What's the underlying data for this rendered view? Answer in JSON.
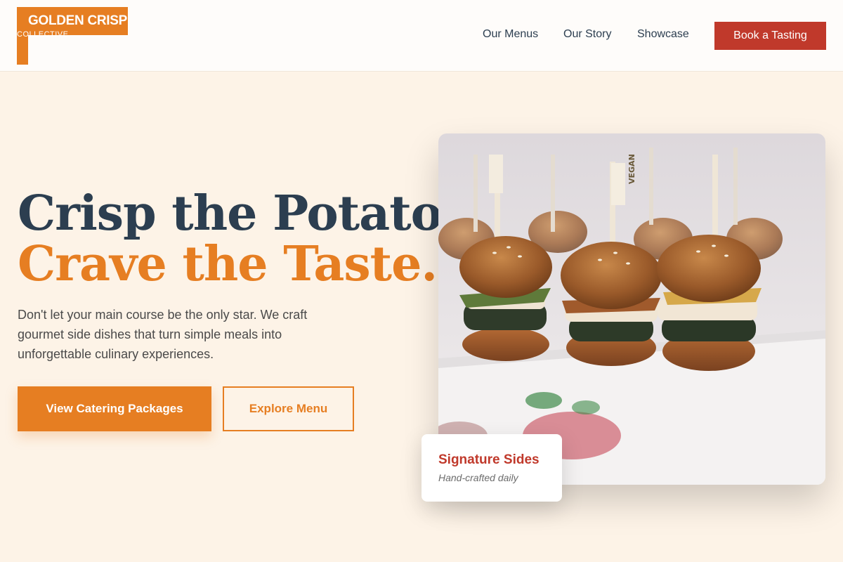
{
  "header": {
    "logo_title": "GOLDEN CRISP",
    "logo_subtitle": "COLLECTIVE",
    "nav": {
      "menus": "Our Menus",
      "story": "Our Story",
      "showcase": "Showcase"
    },
    "cta_label": "Book a Tasting"
  },
  "hero": {
    "title_line1": "Crisp the Potato,",
    "title_line2": "Crave the Taste.",
    "description": "Don't let your main course be the only star. We craft gourmet side dishes that turn simple meals into unforgettable culinary experiences.",
    "primary_button": "View Catering Packages",
    "secondary_button": "Explore Menu",
    "image_pick_label": "VEGAN"
  },
  "card": {
    "title": "Signature Sides",
    "subtitle": "Hand-crafted daily"
  },
  "colors": {
    "brand_orange": "#e67e22",
    "accent_red": "#c0392b",
    "navy": "#2c3e50",
    "background": "#fdf3e7"
  }
}
